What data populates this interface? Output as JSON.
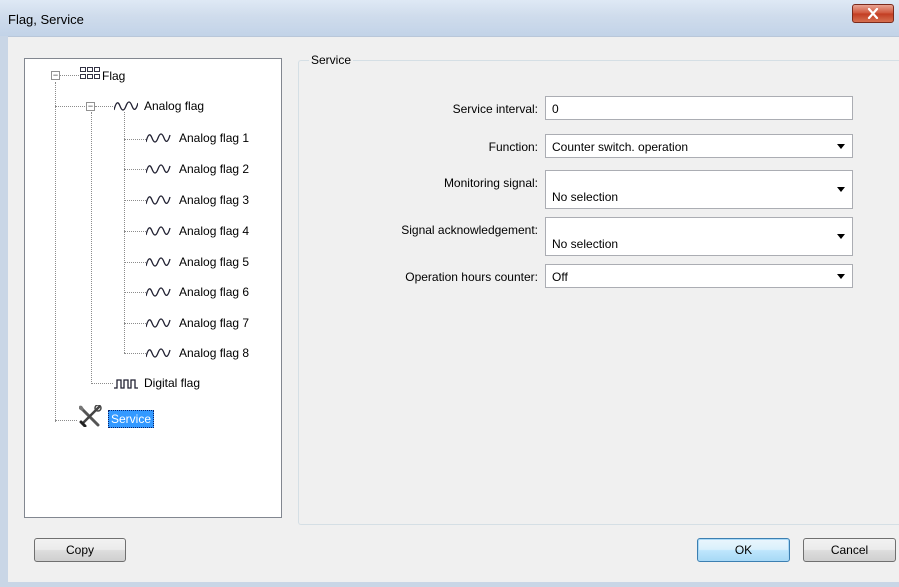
{
  "window": {
    "title": "Flag, Service"
  },
  "tree": {
    "root": {
      "label": "Flag"
    },
    "analog_group": {
      "label": "Analog flag"
    },
    "analog_items": [
      {
        "label": "Analog flag 1"
      },
      {
        "label": "Analog flag 2"
      },
      {
        "label": "Analog flag 3"
      },
      {
        "label": "Analog flag 4"
      },
      {
        "label": "Analog flag 5"
      },
      {
        "label": "Analog flag 6"
      },
      {
        "label": "Analog flag 7"
      },
      {
        "label": "Analog flag 8"
      }
    ],
    "digital": {
      "label": "Digital flag"
    },
    "service": {
      "label": "Service",
      "selected": true
    }
  },
  "service": {
    "group_title": "Service",
    "service_interval": {
      "label": "Service interval:",
      "value": "0"
    },
    "function": {
      "label": "Function:",
      "value": "Counter switch. operation"
    },
    "monitoring_signal": {
      "label": "Monitoring signal:",
      "value": "No selection"
    },
    "signal_ack": {
      "label": "Signal acknowledgement:",
      "value": "No selection"
    },
    "operation_hours": {
      "label": "Operation hours counter:",
      "value": "Off"
    }
  },
  "buttons": {
    "copy": "Copy",
    "ok": "OK",
    "cancel": "Cancel"
  },
  "icons": {
    "close": "close-icon",
    "flag": "flag-grid-icon",
    "analog": "sine-wave-icon",
    "digital": "square-wave-icon",
    "service": "tools-icon",
    "expander": "minus-box-icon",
    "dropdown": "chevron-down-icon"
  },
  "colors": {
    "selection": "#3399ff",
    "close_button": "#c94f33"
  }
}
